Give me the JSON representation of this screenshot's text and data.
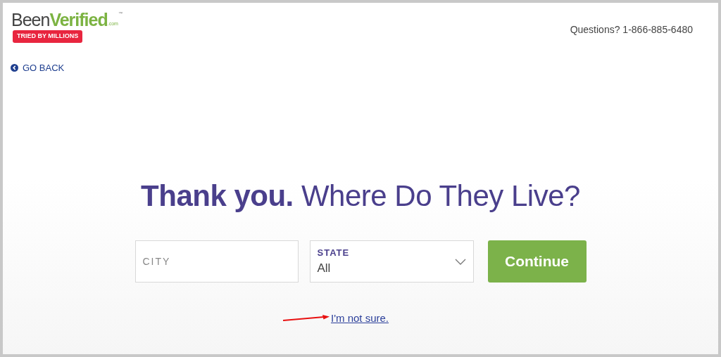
{
  "logo": {
    "name_plain": "Been",
    "name_accent": "Verified",
    "suffix": ".com",
    "trademark": "™",
    "tagline": "TRIED BY MILLIONS"
  },
  "phone": "Questions? 1-866-885-6480",
  "back_link": "GO BACK",
  "headline": "**Thank you.** Where Do They Live?",
  "city_field": {
    "placeholder": "CITY"
  },
  "state_select": {
    "label": "STATE",
    "value": "All"
  },
  "continue_button": "Continue",
  "unsure_link": "I'm not sure."
}
